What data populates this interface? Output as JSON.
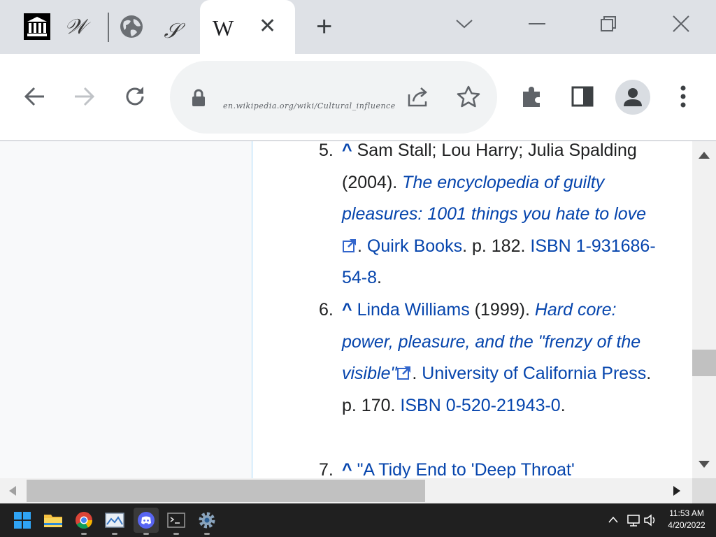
{
  "browser": {
    "tabs": [
      {
        "name": "archive-tab",
        "favicon": "institution-icon",
        "title_glyph": "𝒲"
      },
      {
        "name": "globe-tab",
        "favicon": "globe-icon",
        "title_glyph": "𝒮"
      },
      {
        "name": "wikipedia-tab",
        "favicon": "W",
        "active": true
      }
    ],
    "close_glyph": "✕",
    "new_tab_glyph": "+",
    "url_text": "en.wikipedia.org/wiki/Cultural_influence"
  },
  "article": {
    "refs": [
      {
        "number": "5.",
        "caret": "^",
        "authors": "Sam Stall; Lou Harry; Julia Spalding (2004). ",
        "title": "The encyclopedia of guilty pleasures: 1001 things you hate to love",
        "publisher": "Quirk Books",
        "page": ". p. 182. ",
        "isbn": "ISBN 1-931686-54-8",
        "end": "."
      },
      {
        "number": "6.",
        "caret": "^",
        "author_link": "Linda Williams",
        "year": " (1999). ",
        "title": "Hard core: power, pleasure, and the \"frenzy of the visible\"",
        "publisher": "University of California Press",
        "page": ". p. 170. ",
        "isbn": "ISBN 0-520-21943-0",
        "end": "."
      },
      {
        "number": "7.",
        "caret": "^",
        "title": "\"A Tidy End to 'Deep Throat'"
      }
    ]
  },
  "taskbar": {
    "apps": [
      "start-icon",
      "file-explorer-icon",
      "chrome-icon",
      "photos-icon",
      "discord-icon",
      "terminal-icon",
      "settings-icon"
    ],
    "time": "11:53 AM",
    "date": "4/20/2022"
  },
  "colors": {
    "link": "#0645ad",
    "italic_link": "#3366cc",
    "tabstrip": "#dee1e6",
    "taskbar": "#202020"
  }
}
